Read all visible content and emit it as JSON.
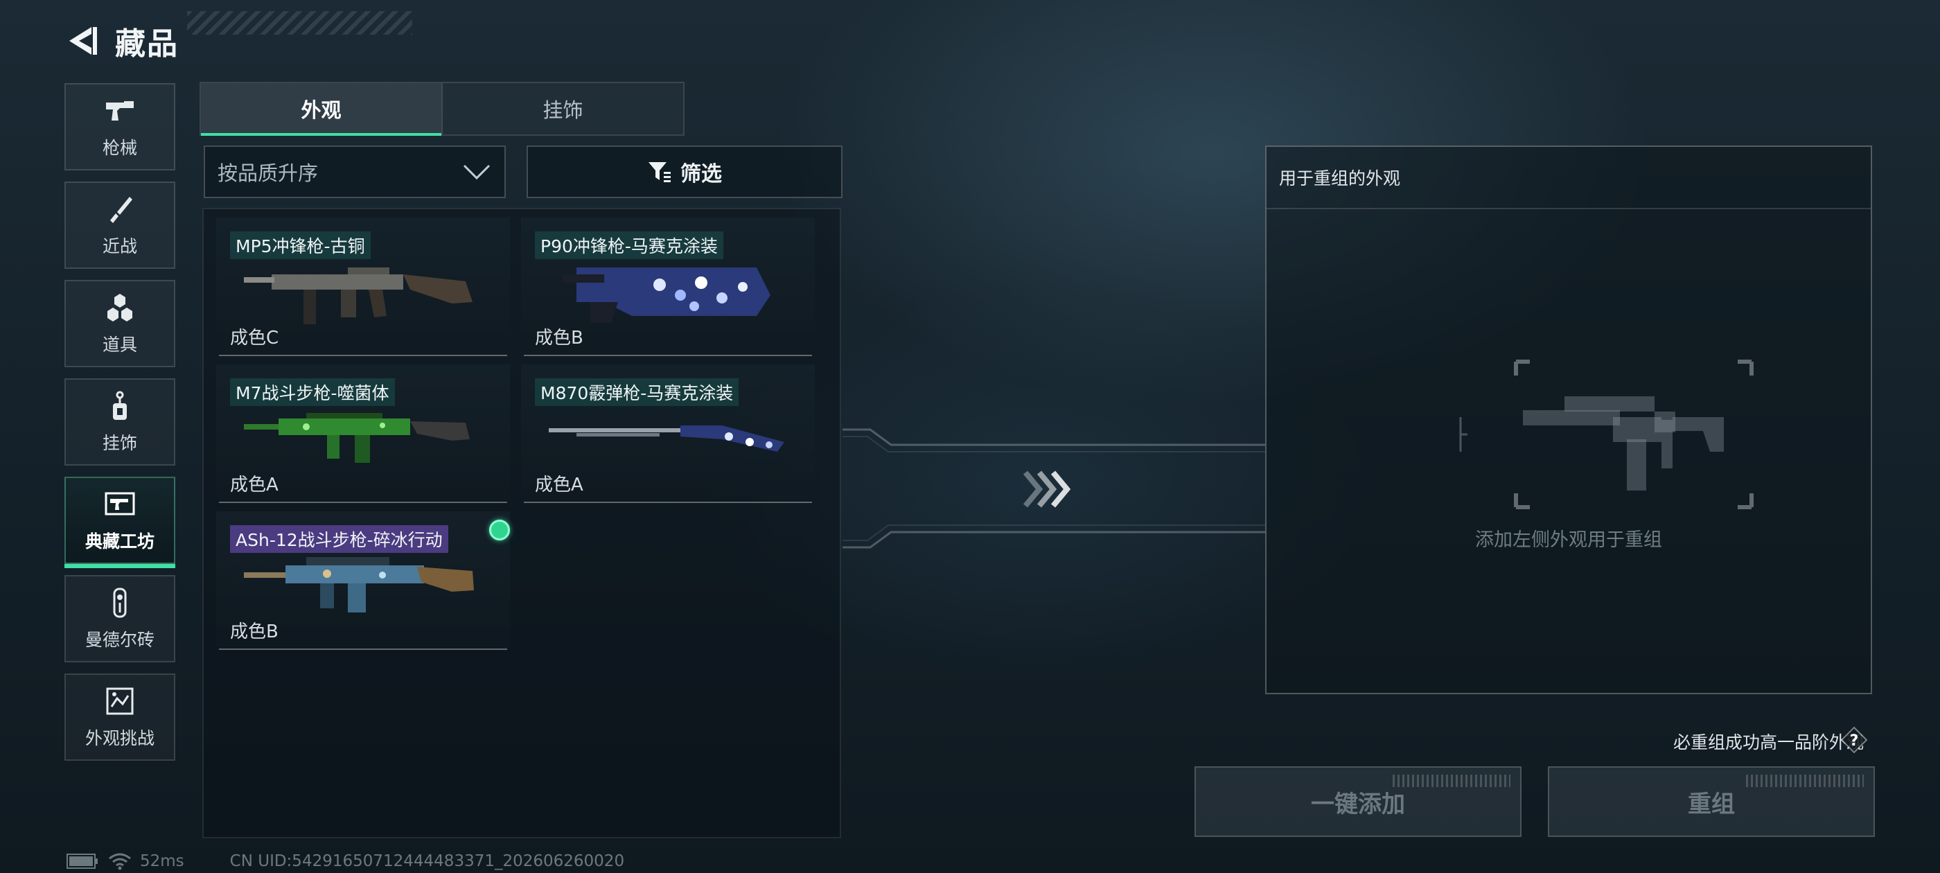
{
  "header": {
    "title": "藏品"
  },
  "side_nav": {
    "items": [
      {
        "label": "枪械",
        "icon": "pistol-icon",
        "active": false
      },
      {
        "label": "近战",
        "icon": "knife-icon",
        "active": false
      },
      {
        "label": "道具",
        "icon": "grenades-icon",
        "active": false
      },
      {
        "label": "挂饰",
        "icon": "charm-icon",
        "active": false
      },
      {
        "label": "典藏工坊",
        "icon": "workshop-icon",
        "active": true
      },
      {
        "label": "曼德尔砖",
        "icon": "brick-icon",
        "active": false
      },
      {
        "label": "外观挑战",
        "icon": "challenge-icon",
        "active": false
      }
    ]
  },
  "tabs": [
    {
      "label": "外观",
      "active": true
    },
    {
      "label": "挂饰",
      "active": false
    }
  ],
  "sort": {
    "value": "按品质升序"
  },
  "filter": {
    "label": "筛选"
  },
  "items": [
    {
      "name": "MP5冲锋枪-古铜",
      "grade": "成色C",
      "skin": "bronze",
      "selected": false
    },
    {
      "name": "P90冲锋枪-马赛克涂装",
      "grade": "成色B",
      "skin": "mosaic",
      "selected": false
    },
    {
      "name": "M7战斗步枪-噬菌体",
      "grade": "成色A",
      "skin": "green",
      "selected": false
    },
    {
      "name": "M870霰弹枪-马赛克涂装",
      "grade": "成色A",
      "skin": "mosaic",
      "selected": false
    },
    {
      "name": "ASh-12战斗步枪-碎冰行动",
      "grade": "成色B",
      "skin": "ice",
      "selected": true
    }
  ],
  "recombine": {
    "header": "用于重组的外观",
    "placeholder": "添加左侧外观用于重组",
    "note": "必重组成功高一品阶外观"
  },
  "buttons": {
    "add_all": "一键添加",
    "recombine": "重组"
  },
  "status": {
    "ping": "52ms",
    "uid": "CN UID:542916507124444833​71_202606260020"
  },
  "colors": {
    "accent": "#3fe0a6",
    "selected_name_bg": "#5f46a0"
  }
}
